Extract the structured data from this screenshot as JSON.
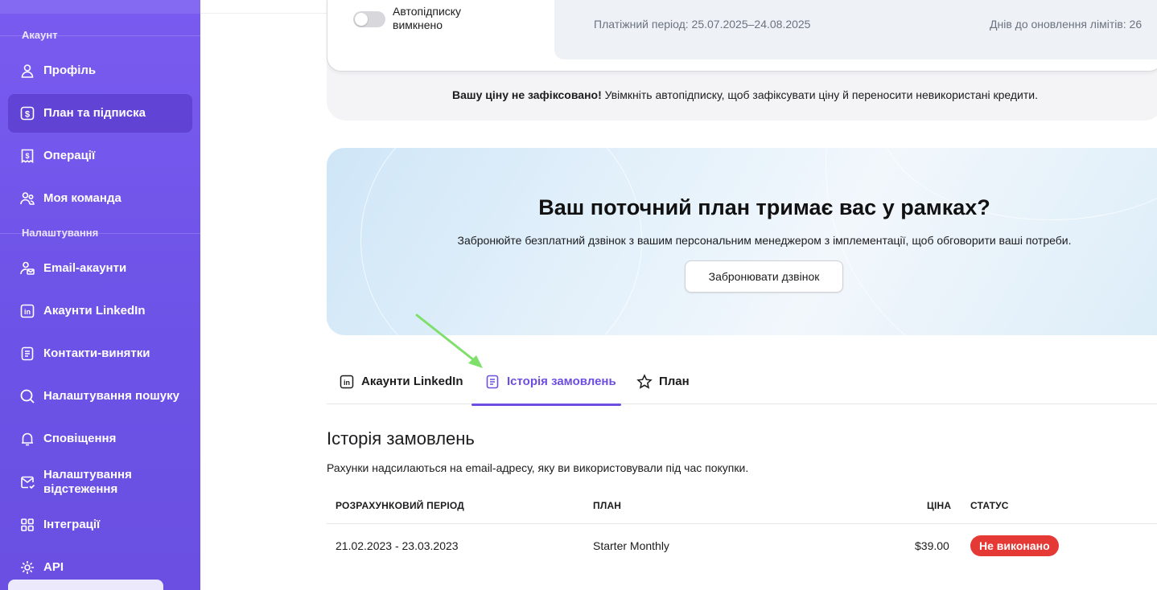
{
  "sidebar": {
    "section_account": "Акаунт",
    "section_settings": "Налаштування",
    "items": [
      {
        "label": "Профіль",
        "icon": "user-icon"
      },
      {
        "label": "План та підписка",
        "icon": "dollar-icon"
      },
      {
        "label": "Операції",
        "icon": "receipt-icon"
      },
      {
        "label": "Моя команда",
        "icon": "team-icon"
      },
      {
        "label": "Email-акаунти",
        "icon": "email-account-icon"
      },
      {
        "label": "Акаунти LinkedIn",
        "icon": "linkedin-icon"
      },
      {
        "label": "Контакти-винятки",
        "icon": "document-icon"
      },
      {
        "label": "Налаштування пошуку",
        "icon": "search-icon"
      },
      {
        "label": "Сповіщення",
        "icon": "bell-icon"
      },
      {
        "label": "Налаштування відстеження",
        "icon": "mail-tracking-icon"
      },
      {
        "label": "Інтеграції",
        "icon": "grid-icon"
      },
      {
        "label": "API",
        "icon": "gear-icon"
      }
    ]
  },
  "subscription": {
    "autorenew_label": "Автопідписку вимкнено",
    "autorenew_on": false,
    "period": "Платіжний період: 25.07.2025–24.08.2025",
    "days_label": "Днів до оновлення лімітів: 26",
    "warning_bold": "Вашу ціну не зафіксовано!",
    "warning_rest": " Увімкніть автопідписку, щоб зафіксувати ціну й переносити невикористані кредити."
  },
  "banner": {
    "title": "Ваш поточний план тримає вас у рамках?",
    "subtitle": "Забронюйте безплатний дзвінок з вашим персональним менеджером з імплементації, щоб обговорити ваші потреби.",
    "button": "Забронювати дзвінок"
  },
  "tabs": [
    {
      "label": "Акаунти LinkedIn",
      "icon": "linkedin-icon",
      "active": false
    },
    {
      "label": "Історія замовлень",
      "icon": "document-icon",
      "active": true
    },
    {
      "label": "План",
      "icon": "star-icon",
      "active": false
    }
  ],
  "order_history": {
    "title": "Історія замовлень",
    "subtitle": "Рахунки надсилаються на email-адресу, яку ви використовували під час покупки.",
    "columns": [
      "РОЗРАХУНКОВИЙ ПЕРІОД",
      "ПЛАН",
      "ЦІНА",
      "СТАТУС"
    ],
    "rows": [
      {
        "period": "21.02.2023 - 23.03.2023",
        "plan": "Starter Monthly",
        "price": "$39.00",
        "status": "Не виконано"
      }
    ]
  },
  "colors": {
    "sidebar": "#6c52e6",
    "accent": "#6d4ee0",
    "status_failed": "#e53935",
    "annotation_arrow": "#7ee06a"
  }
}
